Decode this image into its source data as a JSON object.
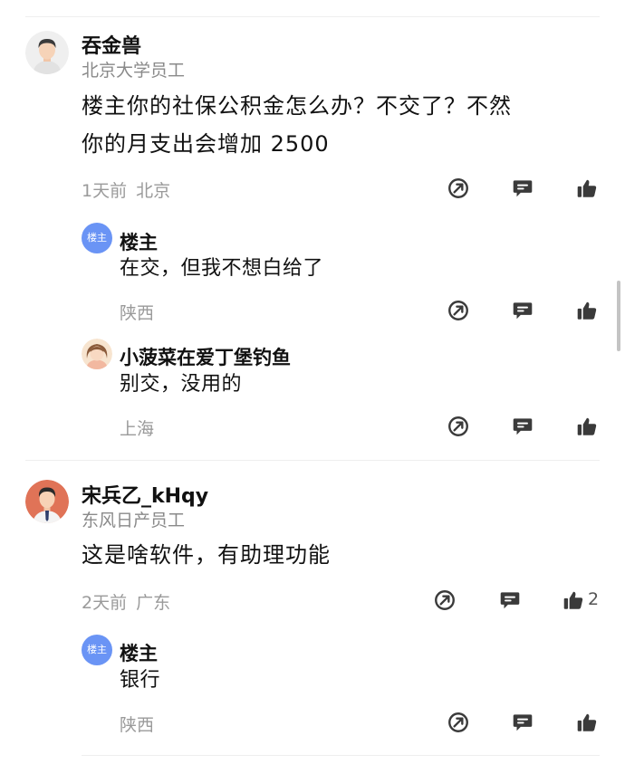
{
  "comments": [
    {
      "name": "吞金兽",
      "subtitle": "北京大学员工",
      "content_line1": "楼主你的社保公积金怎么办？不交了？不然",
      "content_line2": "你的月支出会增加 2500",
      "time": "1天前",
      "location": "北京",
      "like_count": "",
      "replies": [
        {
          "badge": "楼主",
          "name": "楼主",
          "content": "在交，但我不想白给了",
          "location": "陕西"
        },
        {
          "name": "小菠菜在爱丁堡钓鱼",
          "content": "别交，没用的",
          "location": "上海"
        }
      ]
    },
    {
      "name": "宋兵乙_kHqy",
      "subtitle": "东风日产员工",
      "content": "这是啥软件，有助理功能",
      "time": "2天前",
      "location": "广东",
      "like_count": "2",
      "replies": [
        {
          "badge": "楼主",
          "name": "楼主",
          "content": "银行",
          "location": "陕西"
        }
      ]
    }
  ],
  "icons": {
    "share": "share-icon",
    "comment": "comment-icon",
    "like": "thumbs-up-icon"
  },
  "colors": {
    "icon": "#3a3a3a",
    "meta": "#9a9a9a",
    "op_badge": "#6a94f5"
  }
}
